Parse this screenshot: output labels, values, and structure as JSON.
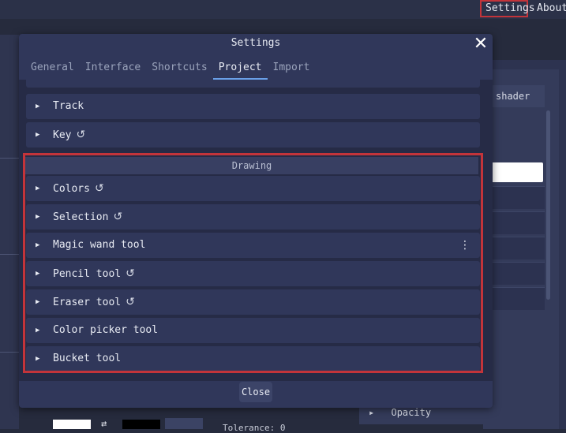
{
  "menu": {
    "settings": "Settings",
    "about": "About"
  },
  "background": {
    "shader_label": "shader",
    "opacity_label": "Opacity",
    "tolerance_label": "Tolerance: 0"
  },
  "dialog": {
    "title": "Settings",
    "close_label": "Close",
    "tabs": [
      "General",
      "Interface",
      "Shortcuts",
      "Project",
      "Import"
    ],
    "active_tab": "Project",
    "rows_top": [
      {
        "label": "Track",
        "revert": false
      },
      {
        "label": "Key",
        "revert": true
      }
    ],
    "section": "Drawing",
    "drawing_rows": [
      {
        "label": "Colors",
        "revert": true
      },
      {
        "label": "Selection",
        "revert": true
      },
      {
        "label": "Magic wand tool",
        "revert": false,
        "menu": true
      },
      {
        "label": "Pencil tool",
        "revert": true
      },
      {
        "label": "Eraser tool",
        "revert": true
      },
      {
        "label": "Color picker tool",
        "revert": false
      },
      {
        "label": "Bucket tool",
        "revert": false
      }
    ]
  },
  "colors": {
    "accent": "#6aa0e8",
    "highlight": "#c3343a",
    "dialog_bg": "#30375a"
  }
}
